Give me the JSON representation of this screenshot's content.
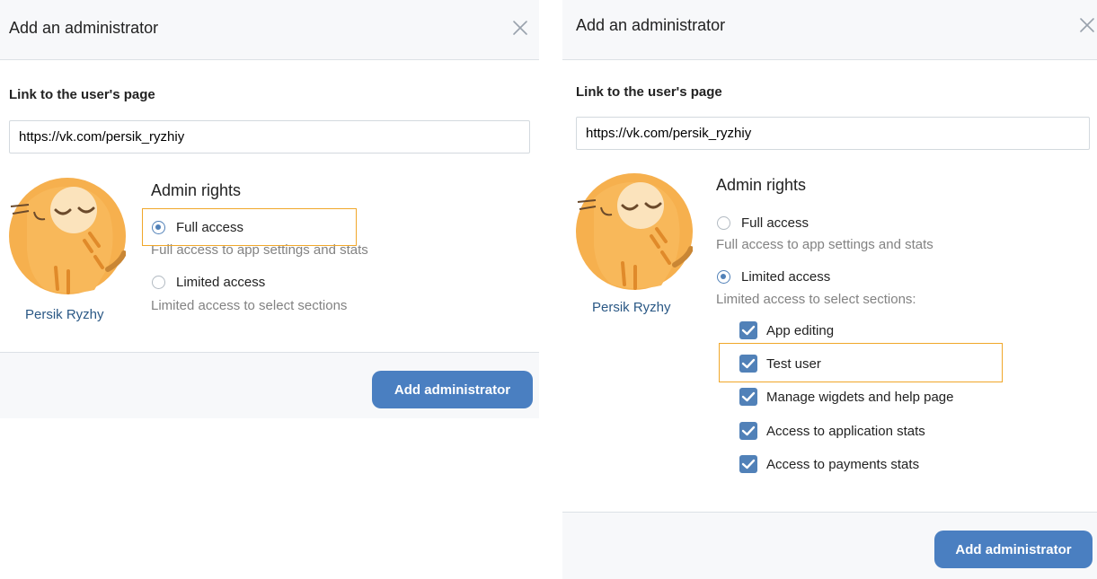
{
  "colors": {
    "accent": "#5181b8",
    "button": "#4a7fc1",
    "highlight": "#f0a72a",
    "link": "#2a5885"
  },
  "left_dialog": {
    "title": "Add an administrator",
    "link_label": "Link to the user's page",
    "link_value": "https://vk.com/persik_ryzhiy",
    "user_name": "Persik Ryzhy",
    "rights_title": "Admin rights",
    "full_access_label": "Full access",
    "full_access_desc": "Full access to app settings and stats",
    "limited_access_label": "Limited access",
    "limited_access_desc": "Limited access to select sections",
    "selected": "full",
    "submit_label": "Add administrator"
  },
  "right_dialog": {
    "title": "Add an administrator",
    "link_label": "Link to the user's page",
    "link_value": "https://vk.com/persik_ryzhiy",
    "user_name": "Persik Ryzhy",
    "rights_title": "Admin rights",
    "full_access_label": "Full access",
    "full_access_desc": "Full access to app settings and stats",
    "limited_access_label": "Limited access",
    "limited_access_desc": "Limited access to select sections:",
    "selected": "limited",
    "sections": [
      {
        "label": "App editing",
        "checked": true
      },
      {
        "label": "Test user",
        "checked": true
      },
      {
        "label": "Manage wigdets and help page",
        "checked": true
      },
      {
        "label": "Access to application stats",
        "checked": true
      },
      {
        "label": "Access to payments stats",
        "checked": true
      }
    ],
    "submit_label": "Add administrator"
  }
}
